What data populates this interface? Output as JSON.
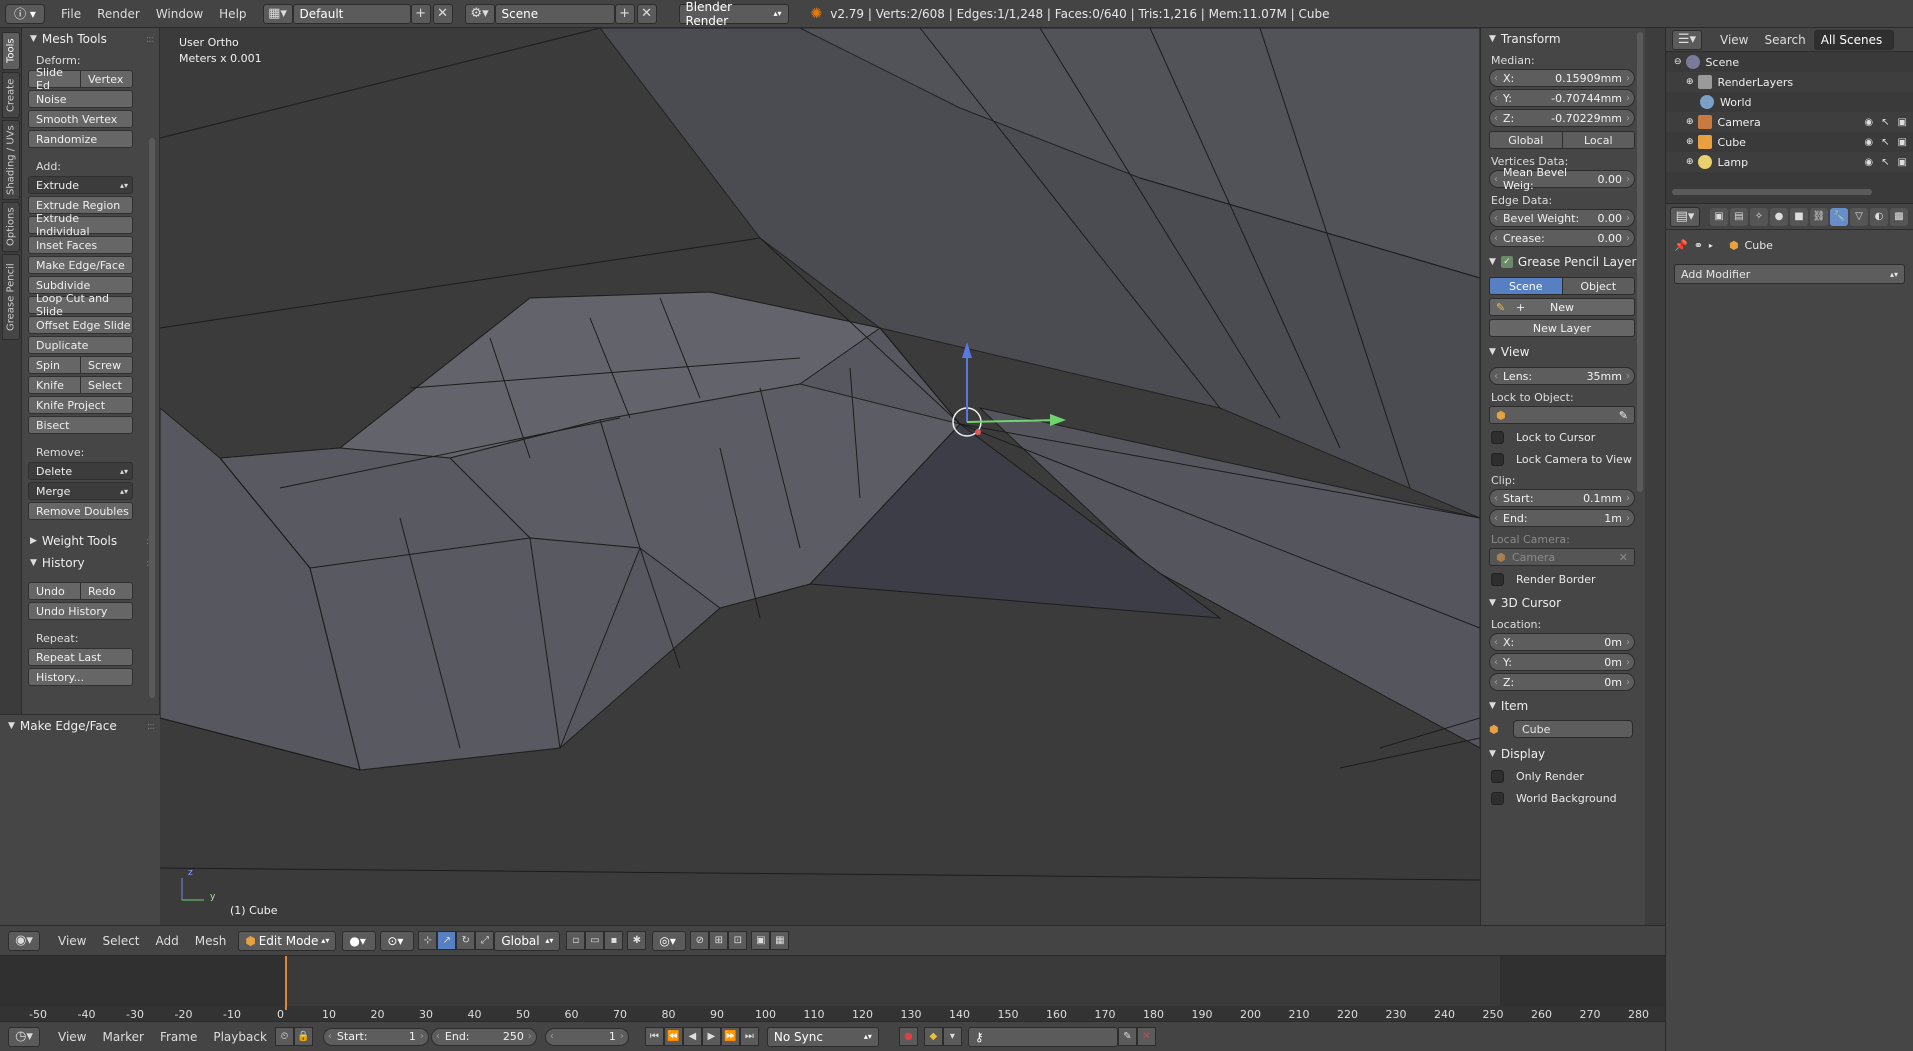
{
  "top_bar": {
    "menus": [
      "File",
      "Render",
      "Window",
      "Help"
    ],
    "layout_name": "Default",
    "scene_name": "Scene",
    "render_engine": "Blender Render",
    "stats": "v2.79 | Verts:2/608 | Edges:1/1,248 | Faces:0/640 | Tris:1,216 | Mem:11.07M | Cube"
  },
  "vertical_tabs": [
    "Tools",
    "Create",
    "Shading / UVs",
    "Options",
    "Grease Pencil"
  ],
  "mesh_tools": {
    "title": "Mesh Tools",
    "deform_label": "Deform:",
    "slide_edge": "Slide Ed",
    "vertex": "Vertex",
    "noise": "Noise",
    "smooth_vertex": "Smooth Vertex",
    "randomize": "Randomize",
    "add_label": "Add:",
    "extrude": "Extrude",
    "extrude_region": "Extrude Region",
    "extrude_individual": "Extrude Individual",
    "inset_faces": "Inset Faces",
    "make_edge_face": "Make Edge/Face",
    "subdivide": "Subdivide",
    "loop_cut": "Loop Cut and Slide",
    "offset_edge": "Offset Edge Slide",
    "duplicate": "Duplicate",
    "spin": "Spin",
    "screw": "Screw",
    "knife": "Knife",
    "select": "Select",
    "knife_project": "Knife Project",
    "bisect": "Bisect",
    "remove_label": "Remove:",
    "delete": "Delete",
    "merge": "Merge",
    "remove_doubles": "Remove Doubles"
  },
  "weight_tools": {
    "title": "Weight Tools"
  },
  "history": {
    "title": "History",
    "undo": "Undo",
    "redo": "Redo",
    "undo_history": "Undo History",
    "repeat_label": "Repeat:",
    "repeat_last": "Repeat Last",
    "history_btn": "History..."
  },
  "operator_panel": {
    "title": "Make Edge/Face"
  },
  "viewport": {
    "view_name": "User Ortho",
    "units": "Meters x 0.001",
    "object_label": "(1) Cube",
    "axis_z": "z",
    "axis_y": "y"
  },
  "transform": {
    "title": "Transform",
    "median_label": "Median:",
    "x_label": "X:",
    "x_value": "0.15909mm",
    "y_label": "Y:",
    "y_value": "-0.70744mm",
    "z_label": "Z:",
    "z_value": "-0.70229mm",
    "global": "Global",
    "local": "Local",
    "vertices_data_label": "Vertices Data:",
    "mean_bevel_label": "Mean Bevel Weig:",
    "mean_bevel_value": "0.00",
    "edge_data_label": "Edge Data:",
    "bevel_weight_label": "Bevel Weight:",
    "bevel_weight_value": "0.00",
    "crease_label": "Crease:",
    "crease_value": "0.00"
  },
  "grease_pencil": {
    "title": "Grease Pencil Layers",
    "scene": "Scene",
    "object": "Object",
    "new": "New",
    "new_layer": "New Layer"
  },
  "view_panel": {
    "title": "View",
    "lens_label": "Lens:",
    "lens_value": "35mm",
    "lock_to_object": "Lock to Object:",
    "lock_to_cursor": "Lock to Cursor",
    "lock_camera": "Lock Camera to View",
    "clip_label": "Clip:",
    "clip_start_label": "Start:",
    "clip_start_value": "0.1mm",
    "clip_end_label": "End:",
    "clip_end_value": "1m",
    "local_camera": "Local Camera:",
    "camera": "Camera",
    "render_border": "Render Border"
  },
  "cursor_panel": {
    "title": "3D Cursor",
    "location_label": "Location:",
    "x_label": "X:",
    "x_value": "0m",
    "y_label": "Y:",
    "y_value": "0m",
    "z_label": "Z:",
    "z_value": "0m"
  },
  "item_panel": {
    "title": "Item",
    "name": "Cube"
  },
  "display_panel": {
    "title": "Display",
    "only_render": "Only Render",
    "world_background": "World Background"
  },
  "outliner": {
    "view": "View",
    "search": "Search",
    "filter": "All Scenes",
    "rows": [
      "Scene",
      "RenderLayers",
      "World",
      "Camera",
      "Cube",
      "Lamp"
    ]
  },
  "properties": {
    "breadcrumb_object": "Cube",
    "add_modifier": "Add Modifier"
  },
  "view3d_header": {
    "view": "View",
    "select": "Select",
    "add": "Add",
    "mesh": "Mesh",
    "mode": "Edit Mode",
    "orientation": "Global"
  },
  "timeline": {
    "ticks": [
      "-50",
      "-40",
      "-30",
      "-20",
      "-10",
      "0",
      "10",
      "20",
      "30",
      "40",
      "50",
      "60",
      "70",
      "80",
      "90",
      "100",
      "110",
      "120",
      "130",
      "140",
      "150",
      "160",
      "170",
      "180",
      "190",
      "200",
      "210",
      "220",
      "230",
      "240",
      "250",
      "260",
      "270",
      "280"
    ],
    "view": "View",
    "marker": "Marker",
    "frame": "Frame",
    "playback": "Playback",
    "start_label": "Start:",
    "start_value": "1",
    "end_label": "End:",
    "end_value": "250",
    "current_frame": "1",
    "sync": "No Sync"
  },
  "colors": {
    "selected_blue": "#5680c2",
    "frame_marker": "#e0843a"
  }
}
